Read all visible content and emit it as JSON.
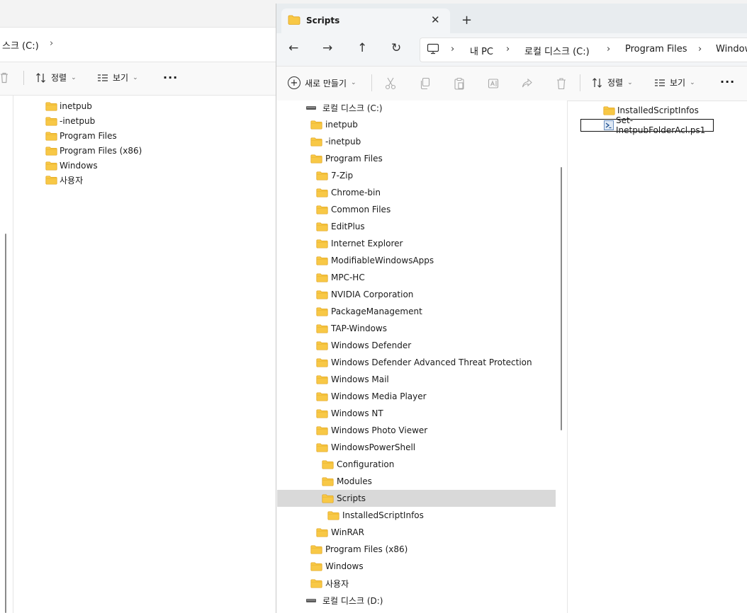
{
  "background_window": {
    "address": {
      "text": "스크 (C:)",
      "chevron": "›"
    },
    "toolbar": {
      "sort_label": "정렬",
      "view_label": "보기",
      "more": "···"
    },
    "tree": [
      {
        "label": "inetpub",
        "icon": "folder-icon"
      },
      {
        "label": "-inetpub",
        "icon": "folder-icon"
      },
      {
        "label": "Program Files",
        "icon": "folder-icon"
      },
      {
        "label": "Program Files (x86)",
        "icon": "folder-icon"
      },
      {
        "label": "Windows",
        "icon": "folder-icon"
      },
      {
        "label": "사용자",
        "icon": "folder-icon"
      }
    ]
  },
  "tab": {
    "title": "Scripts",
    "close": "✕",
    "new_tab": "+"
  },
  "nav": {
    "back": "←",
    "forward": "→",
    "up": "↑",
    "refresh": "↻"
  },
  "breadcrumb": [
    "내 PC",
    "로컬 디스크 (C:)",
    "Program Files",
    "Windows"
  ],
  "toolbar": {
    "new_label": "새로 만들기",
    "sort_label": "정렬",
    "view_label": "보기",
    "more": "···"
  },
  "nav_tree": [
    {
      "label": "로컬 디스크 (C:)",
      "type": "drive"
    },
    {
      "label": "inetpub",
      "type": "folder"
    },
    {
      "label": "-inetpub",
      "type": "folder"
    },
    {
      "label": "Program Files",
      "type": "folder"
    },
    {
      "label": "7-Zip",
      "type": "folder"
    },
    {
      "label": "Chrome-bin",
      "type": "folder"
    },
    {
      "label": "Common Files",
      "type": "folder"
    },
    {
      "label": "EditPlus",
      "type": "folder"
    },
    {
      "label": "Internet Explorer",
      "type": "folder"
    },
    {
      "label": "ModifiableWindowsApps",
      "type": "folder"
    },
    {
      "label": "MPC-HC",
      "type": "folder"
    },
    {
      "label": "NVIDIA Corporation",
      "type": "folder"
    },
    {
      "label": "PackageManagement",
      "type": "folder"
    },
    {
      "label": "TAP-Windows",
      "type": "folder"
    },
    {
      "label": "Windows Defender",
      "type": "folder"
    },
    {
      "label": "Windows Defender Advanced Threat Protection",
      "type": "folder"
    },
    {
      "label": "Windows Mail",
      "type": "folder"
    },
    {
      "label": "Windows Media Player",
      "type": "folder"
    },
    {
      "label": "Windows NT",
      "type": "folder"
    },
    {
      "label": "Windows Photo Viewer",
      "type": "folder"
    },
    {
      "label": "WindowsPowerShell",
      "type": "folder"
    },
    {
      "label": "Configuration",
      "type": "folder"
    },
    {
      "label": "Modules",
      "type": "folder"
    },
    {
      "label": "Scripts",
      "type": "folder",
      "selected": true
    },
    {
      "label": "InstalledScriptInfos",
      "type": "folder"
    },
    {
      "label": "WinRAR",
      "type": "folder"
    },
    {
      "label": "Program Files (x86)",
      "type": "folder"
    },
    {
      "label": "Windows",
      "type": "folder"
    },
    {
      "label": "사용자",
      "type": "folder"
    },
    {
      "label": "로컬 디스크 (D:)",
      "type": "drive"
    }
  ],
  "content": [
    {
      "label": "InstalledScriptInfos",
      "type": "folder"
    },
    {
      "label": "Set-InetpubFolderAcl.ps1",
      "type": "ps1-file"
    }
  ],
  "colors": {
    "folder": "#f8c846",
    "folder_dark": "#e8a419",
    "selection": "#d9d9d9",
    "accent": "#0067c0"
  }
}
